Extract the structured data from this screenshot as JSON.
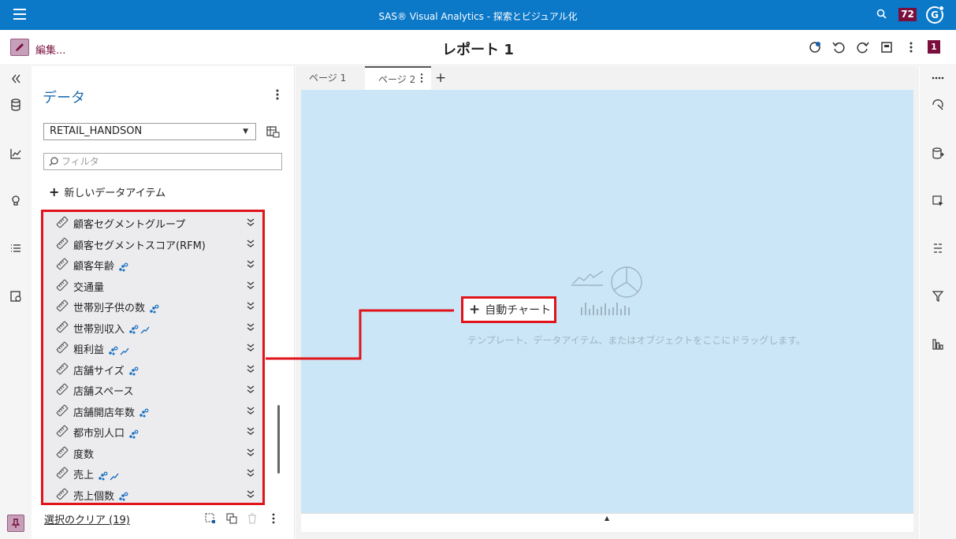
{
  "app": {
    "title": "SAS® Visual Analytics - 探索とビジュアル化",
    "notification_count": "72",
    "user_initial": "G"
  },
  "toolbar": {
    "edit_label": "編集...",
    "report_title": "レポート 1",
    "badge": "1"
  },
  "data_pane": {
    "title": "データ",
    "source": "RETAIL_HANDSON",
    "filter_placeholder": "フィルタ",
    "new_item_label": "新しいデータアイテム",
    "items": [
      {
        "label": "顧客セグメントグループ",
        "indicator": "none"
      },
      {
        "label": "顧客セグメントスコア(RFM)",
        "indicator": "none"
      },
      {
        "label": "顧客年齢",
        "indicator": "scatter"
      },
      {
        "label": "交通量",
        "indicator": "none"
      },
      {
        "label": "世帯別子供の数",
        "indicator": "scatter"
      },
      {
        "label": "世帯別収入",
        "indicator": "scatter-trend"
      },
      {
        "label": "粗利益",
        "indicator": "scatter-trend"
      },
      {
        "label": "店舗サイズ",
        "indicator": "scatter"
      },
      {
        "label": "店舗スペース",
        "indicator": "none"
      },
      {
        "label": "店舗開店年数",
        "indicator": "scatter"
      },
      {
        "label": "都市別人口",
        "indicator": "scatter"
      },
      {
        "label": "度数",
        "indicator": "none"
      },
      {
        "label": "売上",
        "indicator": "scatter-trend"
      },
      {
        "label": "売上個数",
        "indicator": "scatter"
      }
    ],
    "clear_selection": "選択のクリア (19)"
  },
  "canvas": {
    "tabs": [
      "ページ 1",
      "ページ 2"
    ],
    "active_tab": "ページ 2",
    "auto_chart_label": "自動チャート",
    "hint": "テンプレート、データアイテム、またはオブジェクトをここにドラッグします。"
  },
  "colors": {
    "banner": "#0b78c8",
    "accent": "#7a0e3d",
    "canvas": "#cbe6f7",
    "highlight": "#e0141a"
  }
}
